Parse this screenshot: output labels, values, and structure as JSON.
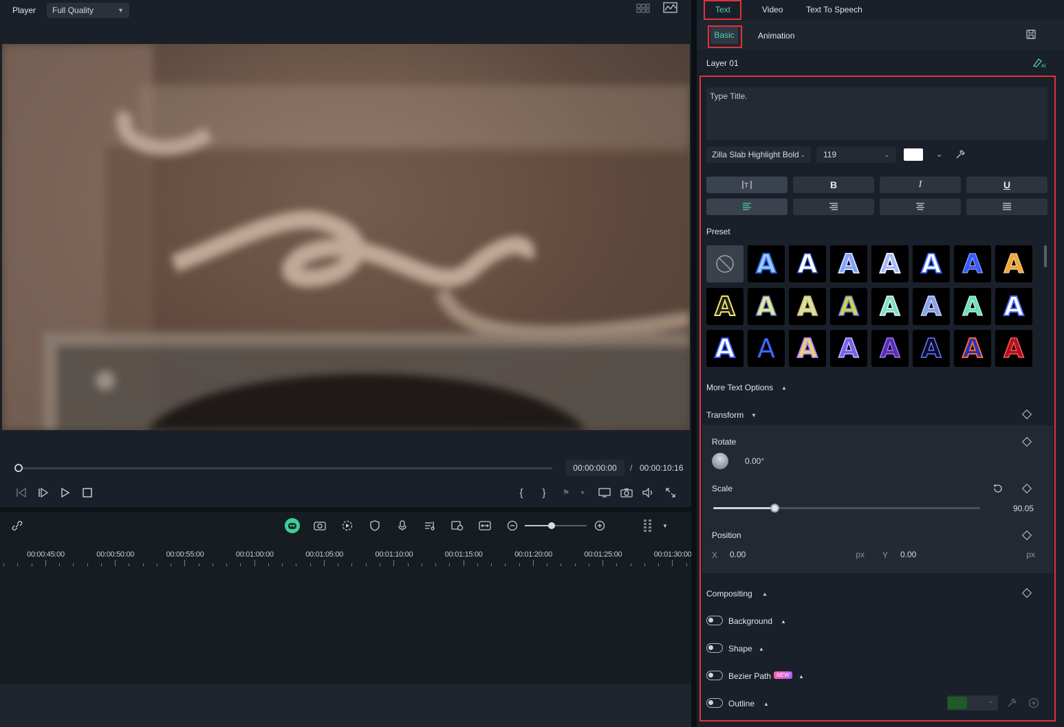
{
  "player": {
    "label": "Player",
    "quality": "Full Quality",
    "time_current": "00:00:00:00",
    "time_separator": "/",
    "time_total": "00:00:10:16"
  },
  "timeline": {
    "ruler": [
      "00:00:45:00",
      "00:00:50:00",
      "00:00:55:00",
      "00:01:00:00",
      "00:01:05:00",
      "00:01:10:00",
      "00:01:15:00",
      "00:01:20:00",
      "00:01:25:00",
      "00:01:30:00"
    ]
  },
  "panel": {
    "tabs": [
      "Text",
      "Video",
      "Text To Speech"
    ],
    "subtabs": [
      "Basic",
      "Animation"
    ],
    "layer": "Layer 01",
    "text_placeholder": "Type Title.",
    "font": "Zilla Slab Highlight Bold",
    "font_size": "119",
    "style_buttons": [
      "B",
      "I",
      "U"
    ],
    "preset_label": "Preset",
    "more_options": "More Text Options",
    "transform": "Transform",
    "rotate_label": "Rotate",
    "rotate_value": "0.00°",
    "scale_label": "Scale",
    "scale_value": "90.05",
    "scale_fraction": 0.23,
    "position_label": "Position",
    "x_label": "X",
    "x_value": "0.00",
    "y_label": "Y",
    "y_value": "0.00",
    "px_unit": "px",
    "compositing": "Compositing",
    "background": "Background",
    "shape": "Shape",
    "bezier": "Bezier Path",
    "new_badge": "NEW",
    "outline": "Outline"
  },
  "colors": {
    "accent": "#4ad6a9",
    "highlight_red": "#e0323c",
    "outline_color": "#1f5a28"
  }
}
